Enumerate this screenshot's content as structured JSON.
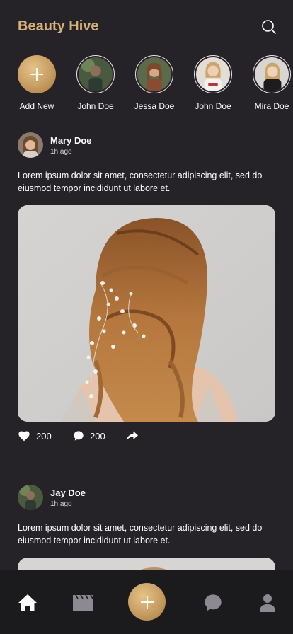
{
  "app": {
    "title": "Beauty Hive",
    "accent": "#d6b27a"
  },
  "header": {
    "search_icon": "search-icon"
  },
  "stories": [
    {
      "name": "Add New",
      "type": "add"
    },
    {
      "name": "John Doe"
    },
    {
      "name": "Jessa Doe"
    },
    {
      "name": "John Doe"
    },
    {
      "name": "Mira Doe"
    }
  ],
  "posts": [
    {
      "author": "Mary Doe",
      "time": "1h ago",
      "caption": "Lorem ipsum dolor sit amet, consectetur adipiscing elit, sed do eiusmod tempor incididunt ut labore et.",
      "likes": "200",
      "comments": "200"
    },
    {
      "author": "Jay Doe",
      "time": "1h ago",
      "caption": "Lorem ipsum dolor sit amet, consectetur adipiscing elit, sed do eiusmod tempor incididunt ut labore et."
    }
  ],
  "navbar": {
    "items": [
      "home-icon",
      "clapperboard-icon",
      "add-icon",
      "chat-icon",
      "profile-icon"
    ],
    "active": "home-icon"
  }
}
